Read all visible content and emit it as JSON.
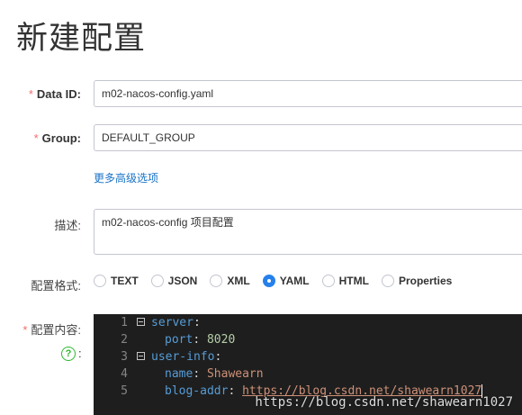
{
  "page": {
    "title": "新建配置"
  },
  "form": {
    "data_id": {
      "label": "Data ID:",
      "required_mark": "*",
      "value": "m02-nacos-config.yaml"
    },
    "group": {
      "label": "Group:",
      "required_mark": "*",
      "value": "DEFAULT_GROUP"
    },
    "advanced_link": "更多高级选项",
    "description": {
      "label": "描述:",
      "value": "m02-nacos-config 项目配置"
    },
    "format": {
      "label": "配置格式:",
      "options": [
        "TEXT",
        "JSON",
        "XML",
        "YAML",
        "HTML",
        "Properties"
      ],
      "selected": "YAML"
    },
    "content": {
      "label": "配置内容:",
      "required_mark": "*",
      "help_icon": "?",
      "help_colon": ":"
    }
  },
  "editor": {
    "line_numbers": [
      "1",
      "2",
      "3",
      "4",
      "5"
    ],
    "lines": [
      {
        "key": "server",
        "colon": ":",
        "value": ""
      },
      {
        "key": "port",
        "colon": ":",
        "value": "8020"
      },
      {
        "key": "user-info",
        "colon": ":",
        "value": ""
      },
      {
        "key": "name",
        "colon": ":",
        "value": "Shawearn"
      },
      {
        "key": "blog-addr",
        "colon": ":",
        "value": "https://blog.csdn.net/shawearn1027"
      }
    ]
  },
  "watermark": "https://blog.csdn.net/shawearn1027",
  "colors": {
    "accent": "#2680eb",
    "required": "#f56c6c",
    "link": "#1a73c7",
    "editor_bg": "#1e1e1e"
  }
}
